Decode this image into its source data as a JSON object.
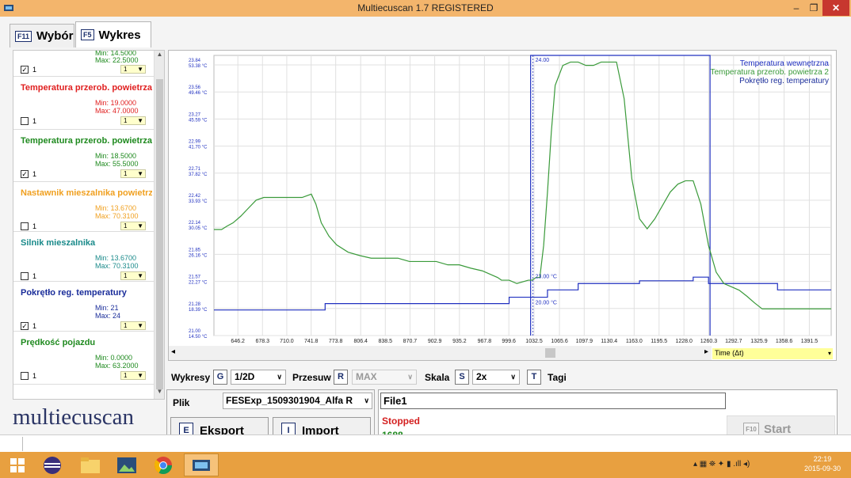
{
  "window": {
    "title": "Multiecuscan 1.7 REGISTERED",
    "min_label": "–",
    "max_label": "❐",
    "close_label": "✕"
  },
  "tabs": [
    {
      "key": "F11",
      "label": "Wybór"
    },
    {
      "key": "F5",
      "label": "Wykres"
    }
  ],
  "sidebar": {
    "items": [
      {
        "name": "",
        "color": "#1f8a1f",
        "min": "Min: 14.5000",
        "max": "Max: 22.5000",
        "checked": true,
        "mark": "✓",
        "num": "1",
        "sel": "1"
      },
      {
        "name": "Temperatura przerob. powietrza",
        "color": "#e02020",
        "min": "Min: 19.0000",
        "max": "Max: 47.0000",
        "checked": false,
        "mark": "",
        "num": "1",
        "sel": "1"
      },
      {
        "name": "Temperatura przerob. powietrza 2",
        "color": "#1f8a1f",
        "min": "Min: 18.5000",
        "max": "Max: 55.5000",
        "checked": true,
        "mark": "✓",
        "num": "1",
        "sel": "1"
      },
      {
        "name": "Nastawnik mieszalnika powietrza",
        "color": "#f0a020",
        "min": "Min: 13.6700",
        "max": "Max: 70.3100",
        "checked": false,
        "mark": "",
        "num": "1",
        "sel": "1"
      },
      {
        "name": "Silnik mieszalnika",
        "color": "#1a8a8a",
        "min": "Min: 13.6700",
        "max": "Max: 70.3100",
        "checked": false,
        "mark": "",
        "num": "1",
        "sel": "1"
      },
      {
        "name": "Pokrętło reg. temperatury",
        "color": "#1a2d9a",
        "min": "Min: 21",
        "max": "Max: 24",
        "checked": true,
        "mark": "✓",
        "num": "1",
        "sel": "1"
      },
      {
        "name": "Prędkość pojazdu",
        "color": "#1f8a1f",
        "min": "Min: 0.0000",
        "max": "Max: 63.2000",
        "checked": false,
        "mark": "",
        "num": "1",
        "sel": "1"
      }
    ],
    "up_arrow": "▲",
    "down_arrow": "▼"
  },
  "logo": "multiecuscan",
  "controls": {
    "wykresy_label": "Wykresy",
    "wykresy_key": "G",
    "wykresy_value": "1/2D",
    "przesuw_label": "Przesuw",
    "przesuw_key": "R",
    "przesuw_value": "MAX",
    "skala_label": "Skala",
    "skala_key": "S",
    "skala_value": "2x",
    "tagi_key": "T",
    "tagi_label": "Tagi",
    "arrow": "∨"
  },
  "file": {
    "label": "Plik",
    "value": "FESExp_1509301904_Alfa R",
    "arrow": "∨"
  },
  "export_button": {
    "key": "E",
    "label": "Eksport"
  },
  "import_button": {
    "key": "I",
    "label": "Import"
  },
  "status": {
    "filename": "File1",
    "state": "Stopped",
    "count": "1688"
  },
  "start_button": {
    "key": "F10",
    "label": "Start"
  },
  "scroll": {
    "left": "◂",
    "right": "▸"
  },
  "time_selector": {
    "label": "Time (Δt)",
    "arrow": "▾"
  },
  "clock": {
    "time": "22:19",
    "date": "2015-09-30"
  },
  "tray": "▴ ▦ ⛯ ✦ ▮ .ıll ◂)",
  "colors": {
    "green": "#3a9a3a",
    "blue": "#2030c0",
    "grid": "#e0e0e0",
    "titlebar": "#f3b56c",
    "taskbar": "#e8a040"
  },
  "chart_data": {
    "type": "line",
    "x_range": [
      615,
      1420
    ],
    "x_ticks": [
      "646.2",
      "678.3",
      "710.0",
      "741.8",
      "773.8",
      "806.4",
      "838.5",
      "870.7",
      "902.9",
      "935.2",
      "967.8",
      "999.6",
      "1032.5",
      "1065.6",
      "1097.9",
      "1130.4",
      "1163.0",
      "1195.5",
      "1228.0",
      "1260.3",
      "1292.7",
      "1325.9",
      "1358.6",
      "1391.5"
    ],
    "y_labels_left_blue": [
      "23.84",
      "23.56",
      "23.27",
      "22.99",
      "22.71",
      "22.42",
      "22.14",
      "21.85",
      "21.57",
      "21.28",
      "21.00"
    ],
    "y_labels_left_green": [
      "53.38 °C",
      "49.46 °C",
      "45.59 °C",
      "41.70 °C",
      "37.82 °C",
      "33.93 °C",
      "30.05 °C",
      "26.16 °C",
      "22.27 °C",
      "18.39 °C",
      "14.50 °C"
    ],
    "series": [
      {
        "name": "Temperatura wewnętrzna",
        "color": "#2030c0",
        "values": []
      },
      {
        "name": "Temperatura przerob. powietrza 2",
        "color": "#3a9a3a",
        "x": [
          615,
          625,
          632,
          640,
          650,
          660,
          670,
          680,
          690,
          700,
          710,
          720,
          730,
          742,
          748,
          755,
          765,
          775,
          790,
          805,
          820,
          838,
          855,
          870,
          890,
          905,
          920,
          935,
          950,
          965,
          975,
          985,
          990,
          1000,
          1010,
          1025,
          1030,
          1035,
          1040,
          1045,
          1050,
          1055,
          1060,
          1070,
          1080,
          1090,
          1100,
          1110,
          1120,
          1130,
          1140,
          1150,
          1160,
          1170,
          1180,
          1190,
          1200,
          1210,
          1220,
          1230,
          1240,
          1250,
          1260,
          1270,
          1280,
          1290,
          1300,
          1310,
          1320,
          1330,
          1340,
          1350,
          1360,
          1370,
          1380,
          1400,
          1420
        ],
        "y": [
          30.4,
          30.4,
          30.9,
          31.4,
          32.4,
          33.6,
          34.8,
          35.2,
          35.2,
          35.2,
          35.2,
          35.2,
          35.2,
          35.7,
          34.2,
          31.4,
          29.4,
          28.1,
          27.0,
          26.5,
          26.1,
          26.1,
          26.1,
          25.6,
          25.6,
          25.6,
          25.1,
          25.1,
          24.6,
          24.2,
          23.7,
          23.2,
          22.8,
          22.8,
          22.3,
          22.8,
          22.8,
          23.2,
          23.2,
          28.0,
          36.0,
          45.0,
          52.0,
          55.0,
          55.5,
          55.5,
          55.0,
          55.0,
          55.5,
          55.5,
          55.5,
          50.0,
          38.0,
          32.0,
          30.5,
          32.0,
          34.0,
          36.0,
          37.2,
          37.7,
          37.7,
          34.2,
          28.0,
          24.0,
          22.3,
          21.8,
          21.3,
          20.4,
          19.4,
          18.5,
          18.5,
          18.5,
          18.5,
          18.5,
          18.5,
          18.5,
          18.5
        ]
      }
    ],
    "blue_series": {
      "x": [
        615,
        742,
        760,
        990,
        1000,
        1035,
        1050,
        1070,
        1090,
        1100,
        1140,
        1170,
        1240,
        1260,
        1300,
        1350,
        1420
      ],
      "y": [
        21.28,
        21.28,
        21.35,
        21.35,
        21.42,
        21.42,
        21.5,
        21.5,
        21.57,
        21.57,
        21.57,
        21.6,
        21.64,
        21.57,
        21.57,
        21.5,
        21.5
      ]
    },
    "spike": {
      "x_start": 1028,
      "x_end": 1262,
      "y_top": 24.0
    },
    "annotations": [
      "24.00",
      "23.00 °C",
      "20.00 °C"
    ],
    "ylim_blue": [
      21.0,
      24.0
    ],
    "ylim_green": [
      14.5,
      56.5
    ]
  }
}
